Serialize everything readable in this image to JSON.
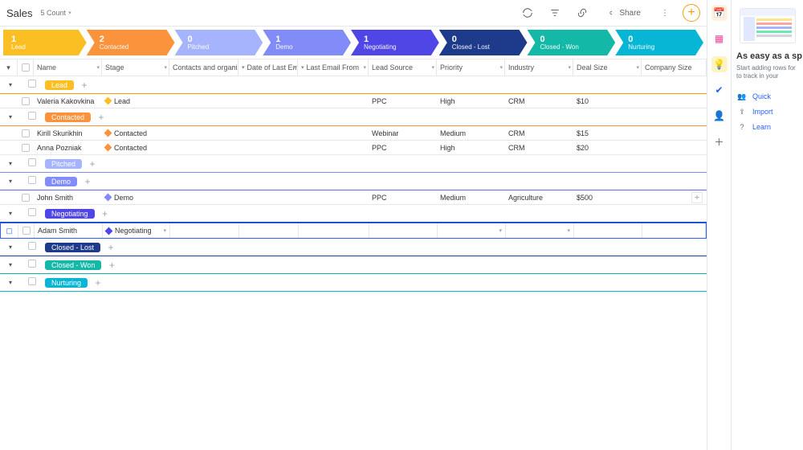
{
  "header": {
    "title": "Sales",
    "count": "5 Count",
    "share": "Share"
  },
  "pipeline": [
    {
      "n": "1",
      "l": "Lead",
      "color": "#fbbf24"
    },
    {
      "n": "2",
      "l": "Contacted",
      "color": "#fb923c"
    },
    {
      "n": "0",
      "l": "Pitched",
      "color": "#a5b4fc"
    },
    {
      "n": "1",
      "l": "Demo",
      "color": "#818cf8"
    },
    {
      "n": "1",
      "l": "Negotiating",
      "color": "#4f46e5"
    },
    {
      "n": "0",
      "l": "Closed - Lost",
      "color": "#1e3a8a"
    },
    {
      "n": "0",
      "l": "Closed - Won",
      "color": "#14b8a6"
    },
    {
      "n": "0",
      "l": "Nurturing",
      "color": "#06b6d4"
    }
  ],
  "columns": {
    "name": "Name",
    "stage": "Stage",
    "contacts": "Contacts and organizati",
    "dle": "Date of Last Email",
    "lef": "Last Email From",
    "src": "Lead Source",
    "prio": "Priority",
    "ind": "Industry",
    "deal": "Deal Size",
    "comp": "Company Size"
  },
  "groups": [
    {
      "label": "Lead",
      "color": "#fbbf24",
      "border": "gborder-yellow",
      "rows": [
        {
          "name": "Valeria Kakovkina",
          "stage": "Lead",
          "dot": "#fbbf24",
          "src": "PPC",
          "prio": "High",
          "ind": "CRM",
          "deal": "$10"
        }
      ]
    },
    {
      "label": "Contacted",
      "color": "#fb923c",
      "border": "gborder-orange",
      "rows": [
        {
          "name": "Kirill Skurikhin",
          "stage": "Contacted",
          "dot": "#fb923c",
          "src": "Webinar",
          "prio": "Medium",
          "ind": "CRM",
          "deal": "$15"
        },
        {
          "name": "Anna Pozniak",
          "stage": "Contacted",
          "dot": "#fb923c",
          "src": "PPC",
          "prio": "High",
          "ind": "CRM",
          "deal": "$20"
        }
      ]
    },
    {
      "label": "Pitched",
      "color": "#a5b4fc",
      "border": "gborder-purple",
      "rows": []
    },
    {
      "label": "Demo",
      "color": "#818cf8",
      "border": "gborder-blue",
      "rows": [
        {
          "name": "John Smith",
          "stage": "Demo",
          "dot": "#818cf8",
          "src": "PPC",
          "prio": "Medium",
          "ind": "Agriculture",
          "deal": "$500",
          "hasAdd": true
        }
      ]
    },
    {
      "label": "Negotiating",
      "color": "#4f46e5",
      "border": "gborder-navy",
      "rows": [
        {
          "name": "Adam Smith",
          "stage": "Negotiating",
          "dot": "#4f46e5",
          "editing": true
        }
      ]
    },
    {
      "label": "Closed - Lost",
      "color": "#1e3a8a",
      "border": "gborder-navy",
      "rows": []
    },
    {
      "label": "Closed - Won",
      "color": "#14b8a6",
      "border": "gborder-teal",
      "rows": []
    },
    {
      "label": "Nurturing",
      "color": "#06b6d4",
      "border": "gborder-cyan",
      "rows": []
    }
  ],
  "rightPanel": {
    "heading": "As easy as a sp",
    "sub": "Start adding rows for to track in your",
    "links": [
      "Quick",
      "Import",
      "Learn"
    ]
  }
}
